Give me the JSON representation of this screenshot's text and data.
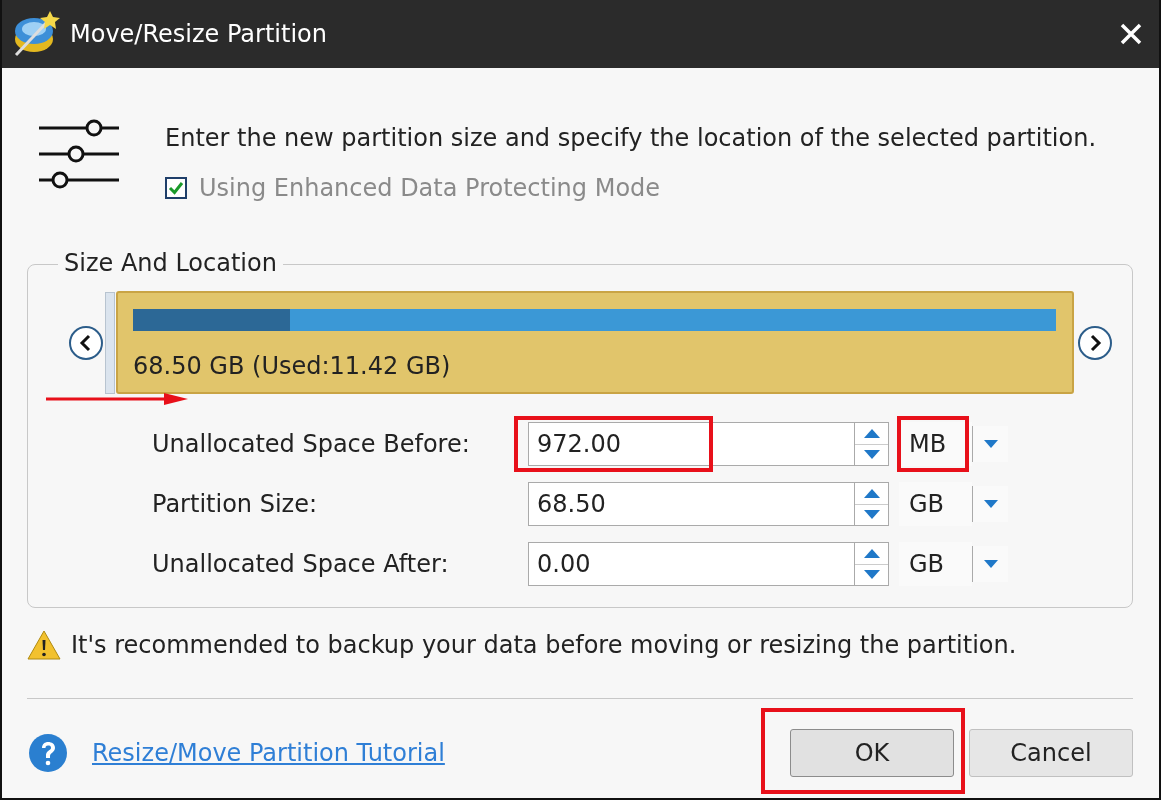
{
  "window": {
    "title": "Move/Resize Partition"
  },
  "description": "Enter the new partition size and specify the location of the selected partition.",
  "protect_mode": {
    "label": "Using Enhanced Data Protecting Mode",
    "checked": true,
    "disabled": true
  },
  "size_and_location": {
    "title": "Size And Location",
    "partition": {
      "label": "68.50 GB (Used:11.42 GB)",
      "level": 0.17
    },
    "fields": [
      {
        "label": "Unallocated Space Before:",
        "value": "972.00",
        "unit": "MB",
        "highlighted": true
      },
      {
        "label": "Partition Size:",
        "value": "68.50",
        "unit": "GB",
        "highlighted": false
      },
      {
        "label": "Unallocated Space After:",
        "value": "0.00",
        "unit": "GB",
        "highlighted": false
      }
    ]
  },
  "warning": "It's recommended to backup your data before moving or resizing the partition.",
  "tutorial_link": "Resize/Move Partition Tutorial",
  "buttons": [
    {
      "label": "OK",
      "highlighted": true
    },
    {
      "label": "Cancel",
      "highlighted": false
    }
  ]
}
